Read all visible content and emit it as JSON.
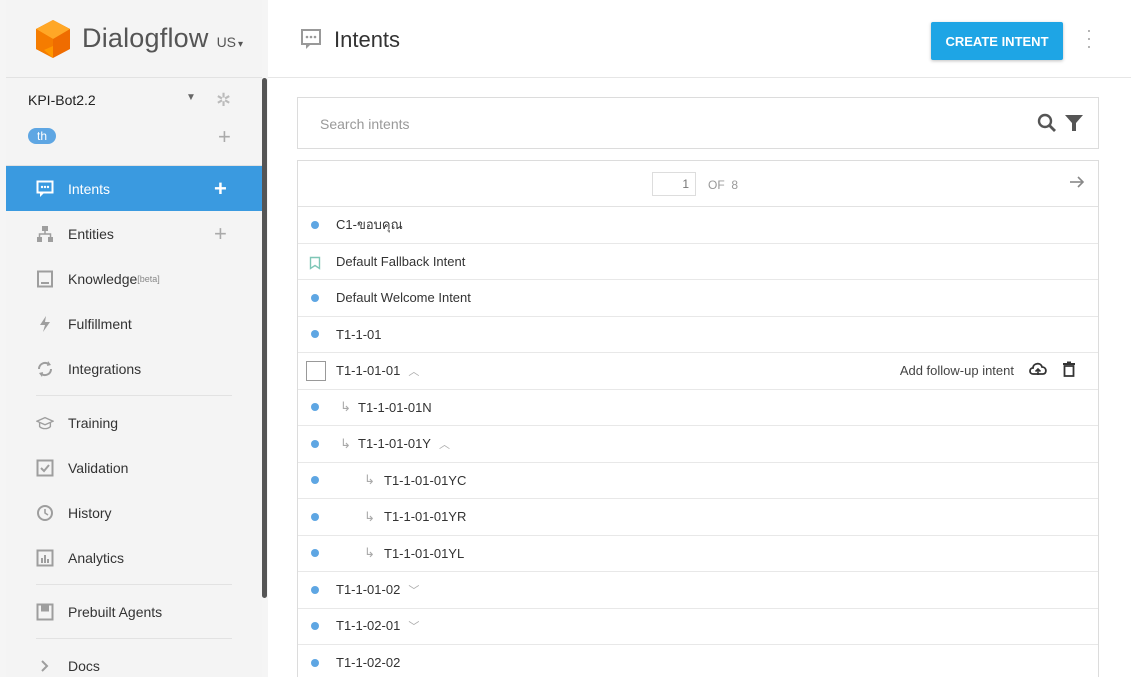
{
  "brand": {
    "name": "Dialogflow",
    "region": "US"
  },
  "agent": {
    "name": "KPI-Bot2.2",
    "language": "th"
  },
  "nav": [
    {
      "id": "intents",
      "label": "Intents",
      "icon": "chat-icon",
      "add": true,
      "active": true
    },
    {
      "id": "entities",
      "label": "Entities",
      "icon": "entities-icon",
      "add": true
    },
    {
      "id": "knowledge",
      "label": "Knowledge",
      "badge": "[beta]",
      "icon": "book-icon"
    },
    {
      "id": "fulfillment",
      "label": "Fulfillment",
      "icon": "bolt-icon"
    },
    {
      "id": "integrations",
      "label": "Integrations",
      "icon": "sync-icon"
    },
    {
      "id": "training",
      "label": "Training",
      "icon": "cap-icon"
    },
    {
      "id": "validation",
      "label": "Validation",
      "icon": "check-box-icon"
    },
    {
      "id": "history",
      "label": "History",
      "icon": "clock-icon"
    },
    {
      "id": "analytics",
      "label": "Analytics",
      "icon": "bar-chart-icon"
    },
    {
      "id": "prebuilt",
      "label": "Prebuilt Agents",
      "icon": "agent-icon"
    },
    {
      "id": "docs",
      "label": "Docs",
      "icon": "chevron-right-icon"
    }
  ],
  "header": {
    "title": "Intents",
    "create_label": "CREATE INTENT"
  },
  "search": {
    "placeholder": "Search intents"
  },
  "pager": {
    "current": "1",
    "of_label": "OF",
    "total": "8"
  },
  "intents": [
    {
      "name": "C1-ขอบคุณ",
      "marker": "dot"
    },
    {
      "name": "Default Fallback Intent",
      "marker": "bookmark"
    },
    {
      "name": "Default Welcome Intent",
      "marker": "dot"
    },
    {
      "name": "T1-1-01",
      "marker": "dot"
    },
    {
      "name": "T1-1-01-01",
      "marker": "checkbox",
      "chevron": "up",
      "action_label": "Add follow-up intent"
    },
    {
      "name": "T1-1-01-01N",
      "marker": "dot",
      "level": 1
    },
    {
      "name": "T1-1-01-01Y",
      "marker": "dot",
      "level": 1,
      "chevron": "up"
    },
    {
      "name": "T1-1-01-01YC",
      "marker": "dot",
      "level": 2
    },
    {
      "name": "T1-1-01-01YR",
      "marker": "dot",
      "level": 2
    },
    {
      "name": "T1-1-01-01YL",
      "marker": "dot",
      "level": 2
    },
    {
      "name": "T1-1-01-02",
      "marker": "dot",
      "chevron": "down"
    },
    {
      "name": "T1-1-02-01",
      "marker": "dot",
      "chevron": "down"
    },
    {
      "name": "T1-1-02-02",
      "marker": "dot"
    }
  ]
}
